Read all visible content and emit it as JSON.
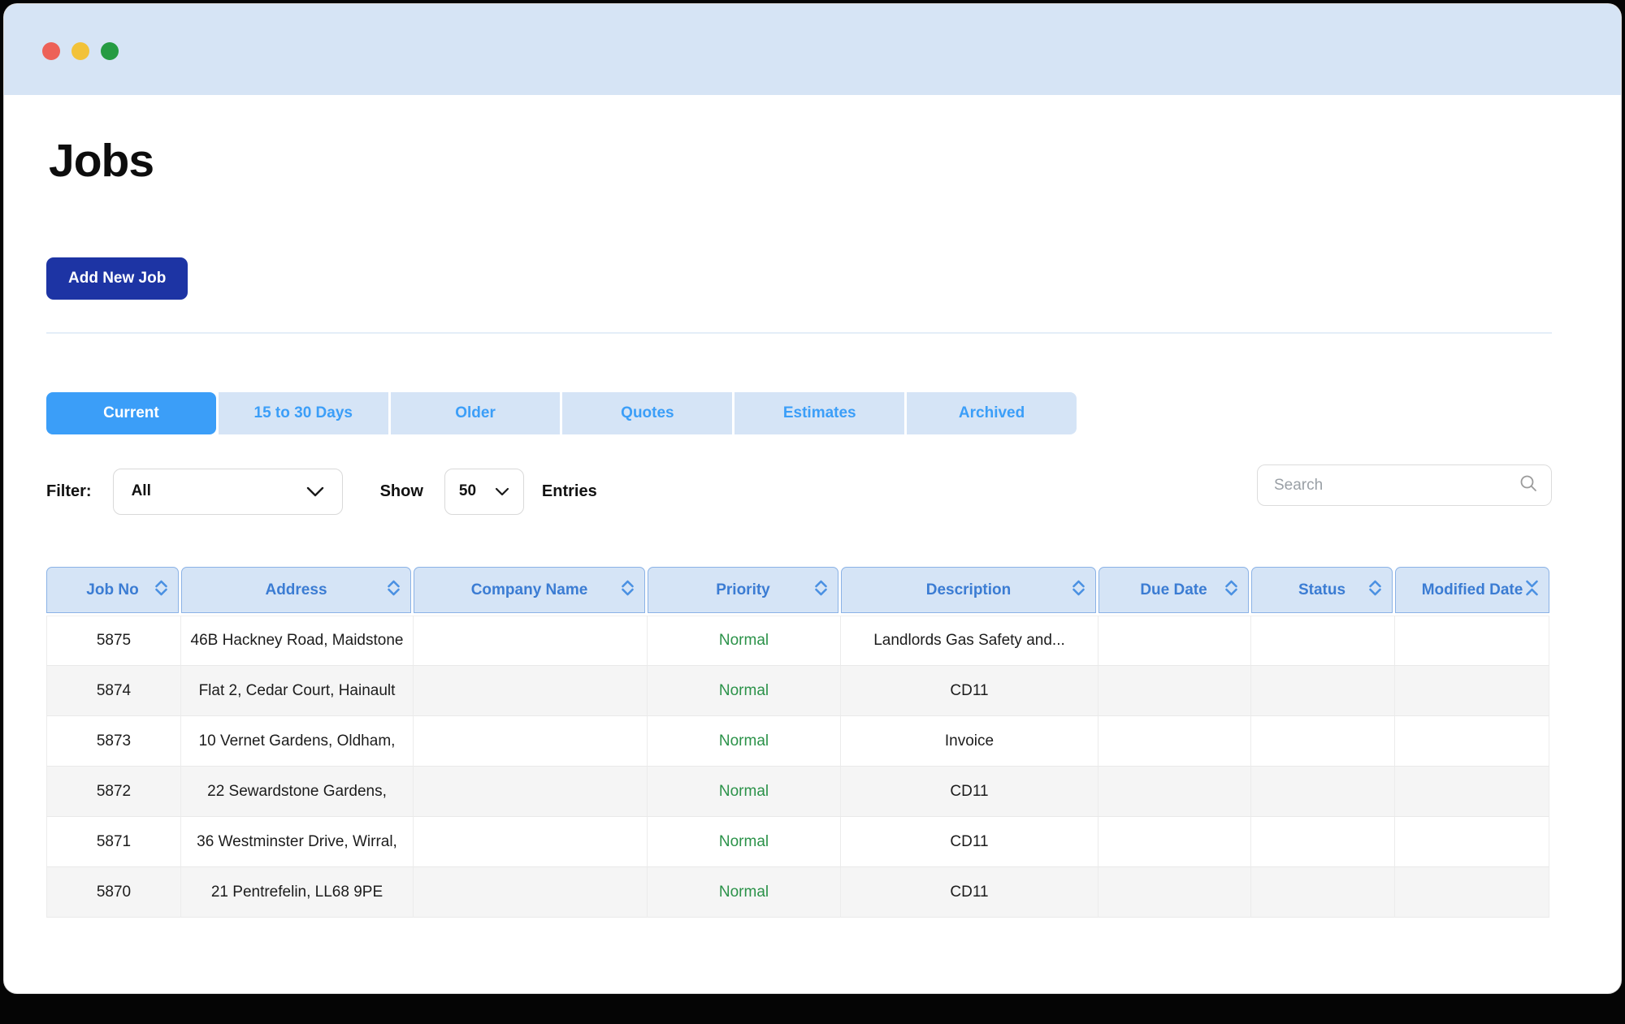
{
  "window": {
    "traffic_lights": [
      "close",
      "minimize",
      "zoom"
    ]
  },
  "page": {
    "title": "Jobs",
    "add_button_label": "Add New Job"
  },
  "tabs": [
    {
      "label": "Current",
      "active": true
    },
    {
      "label": "15 to 30 Days",
      "active": false
    },
    {
      "label": "Older",
      "active": false
    },
    {
      "label": "Quotes",
      "active": false
    },
    {
      "label": "Estimates",
      "active": false
    },
    {
      "label": "Archived",
      "active": false
    }
  ],
  "filters": {
    "filter_label": "Filter:",
    "filter_value": "All",
    "show_label": "Show",
    "show_value": "50",
    "entries_label": "Entries",
    "search_placeholder": "Search"
  },
  "table": {
    "columns": [
      {
        "label": "Job No",
        "key": "job_no",
        "sort": "default"
      },
      {
        "label": "Address",
        "key": "address",
        "sort": "default"
      },
      {
        "label": "Company Name",
        "key": "company_name",
        "sort": "default"
      },
      {
        "label": "Priority",
        "key": "priority",
        "sort": "default"
      },
      {
        "label": "Description",
        "key": "description",
        "sort": "default"
      },
      {
        "label": "Due Date",
        "key": "due_date",
        "sort": "default"
      },
      {
        "label": "Status",
        "key": "status",
        "sort": "default"
      },
      {
        "label": "Modified Date",
        "key": "modified_date",
        "sort": "active"
      }
    ],
    "rows": [
      {
        "job_no": "5875",
        "address": "46B Hackney Road, Maidstone",
        "company_name": "",
        "priority": "Normal",
        "description": "Landlords Gas Safety and...",
        "due_date": "",
        "status": "",
        "modified_date": ""
      },
      {
        "job_no": "5874",
        "address": "Flat 2, Cedar Court, Hainault",
        "company_name": "",
        "priority": "Normal",
        "description": "CD11",
        "due_date": "",
        "status": "",
        "modified_date": ""
      },
      {
        "job_no": "5873",
        "address": "10 Vernet Gardens, Oldham,",
        "company_name": "",
        "priority": "Normal",
        "description": "Invoice",
        "due_date": "",
        "status": "",
        "modified_date": ""
      },
      {
        "job_no": "5872",
        "address": "22 Sewardstone Gardens,",
        "company_name": "",
        "priority": "Normal",
        "description": "CD11",
        "due_date": "",
        "status": "",
        "modified_date": ""
      },
      {
        "job_no": "5871",
        "address": "36 Westminster Drive, Wirral,",
        "company_name": "",
        "priority": "Normal",
        "description": "CD11",
        "due_date": "",
        "status": "",
        "modified_date": ""
      },
      {
        "job_no": "5870",
        "address": "21 Pentrefelin, LL68 9PE",
        "company_name": "",
        "priority": "Normal",
        "description": "CD11",
        "due_date": "",
        "status": "",
        "modified_date": ""
      }
    ]
  },
  "colors": {
    "titlebar_bg": "#d6e4f5",
    "accent_blue": "#3b9ef8",
    "header_text_blue": "#3b7cd3",
    "header_bg": "#d5e4f6",
    "button_navy": "#1d34a4",
    "priority_green": "#2b9249",
    "traffic_red": "#ed6158",
    "traffic_yellow": "#f2c239",
    "traffic_green": "#259b42"
  }
}
